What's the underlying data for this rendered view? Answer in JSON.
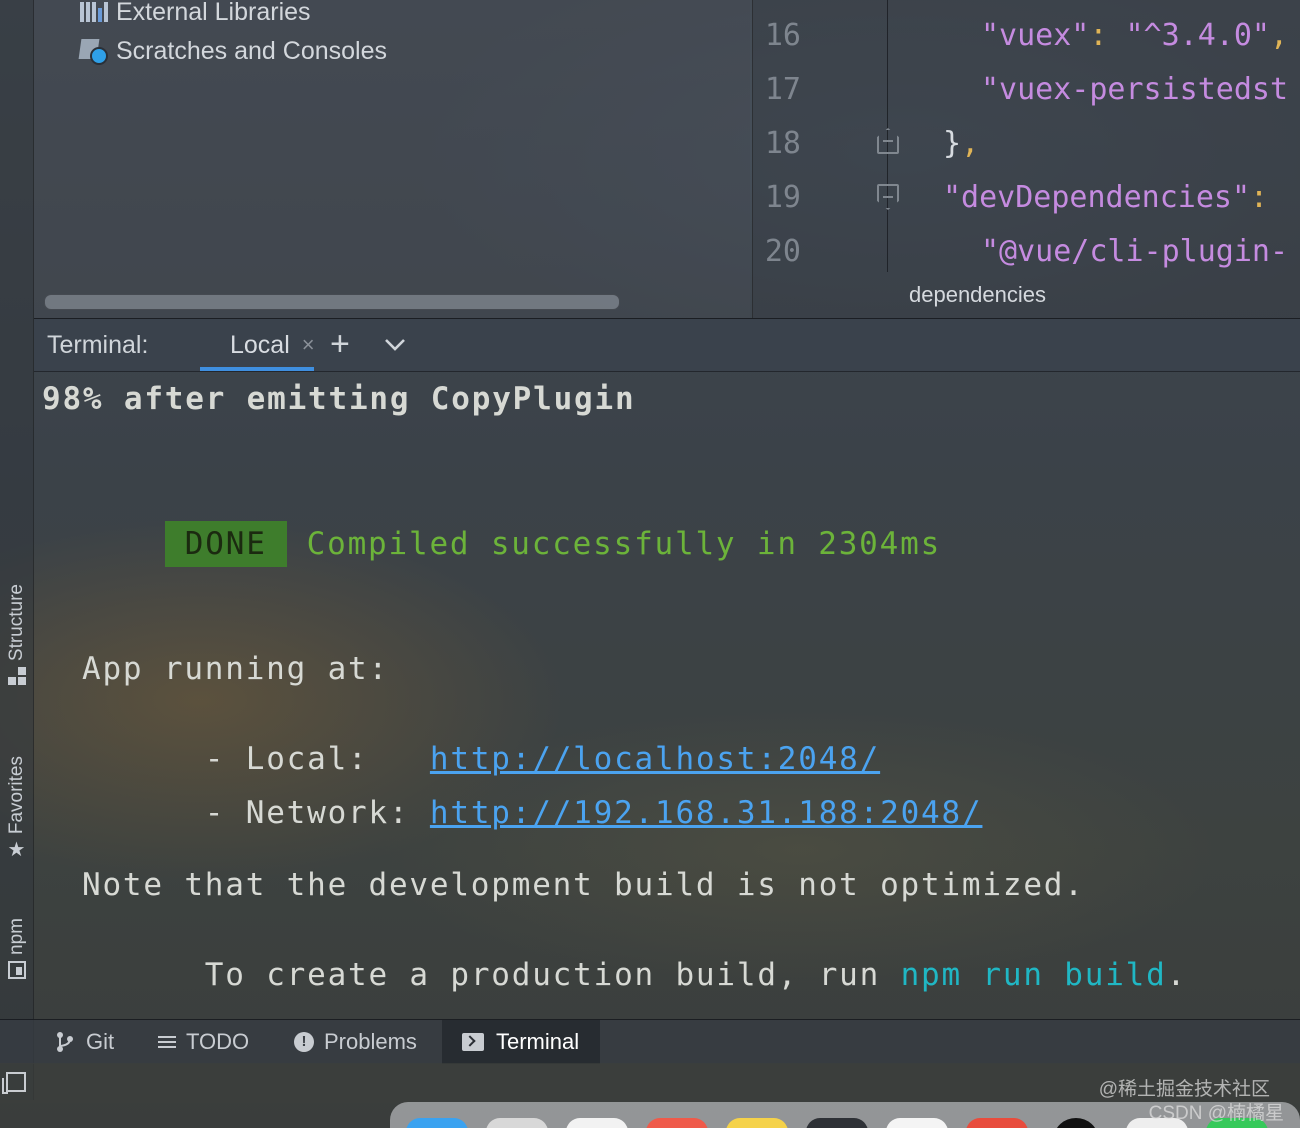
{
  "sidebar_tabs": {
    "structure": "Structure",
    "favorites": "Favorites",
    "npm": "npm"
  },
  "project_tree": {
    "items": [
      {
        "label": "External Libraries",
        "icon": "library-icon"
      },
      {
        "label": "Scratches and Consoles",
        "icon": "scratch-icon"
      }
    ]
  },
  "editor": {
    "lines": [
      {
        "num": "16",
        "indent": 2,
        "parts": [
          {
            "t": "\"vuex\"",
            "c": "str"
          },
          {
            "t": ": ",
            "c": "colon"
          },
          {
            "t": "\"^3.4.0\"",
            "c": "str"
          },
          {
            "t": ",",
            "c": "colon"
          }
        ]
      },
      {
        "num": "17",
        "indent": 2,
        "parts": [
          {
            "t": "\"vuex-persistedst",
            "c": "str"
          }
        ]
      },
      {
        "num": "18",
        "indent": 1,
        "parts": [
          {
            "t": "}",
            "c": "punc"
          },
          {
            "t": ",",
            "c": "colon"
          }
        ]
      },
      {
        "num": "19",
        "indent": 1,
        "parts": [
          {
            "t": "\"devDependencies\"",
            "c": "str"
          },
          {
            "t": ":",
            "c": "colon"
          }
        ]
      },
      {
        "num": "20",
        "indent": 2,
        "parts": [
          {
            "t": "\"@vue/cli-plugin-",
            "c": "str"
          }
        ]
      }
    ],
    "breadcrumb": "dependencies"
  },
  "terminal": {
    "title": "Terminal:",
    "tab_label": "Local",
    "close_glyph": "×",
    "add_glyph": "+",
    "progress_line": "98% after emitting CopyPlugin",
    "done_badge": "DONE",
    "compiled_message": "Compiled successfully in 2304ms",
    "app_running": "App running at:",
    "local_label": "- Local:   ",
    "local_url": "http://localhost:2048/",
    "network_label": "- Network: ",
    "network_url": "http://192.168.31.188:2048/",
    "note_line": "Note that the development build is not optimized.",
    "create_prefix": "To create a production build, run ",
    "create_command": "npm run build",
    "create_suffix": "."
  },
  "bottom_tools": {
    "git": "Git",
    "todo": "TODO",
    "problems": "Problems",
    "terminal": "Terminal"
  },
  "watermark": {
    "line1": "@稀土掘金技术社区",
    "line2": "CSDN @楠橘星"
  },
  "colors": {
    "accent": "#3f8fe0",
    "done_bg": "#3e7d2c",
    "success_text": "#6cb33a",
    "link": "#4ba3f0",
    "command": "#20b7c4",
    "json_string": "#c58be0",
    "json_punct": "#e0b456"
  }
}
